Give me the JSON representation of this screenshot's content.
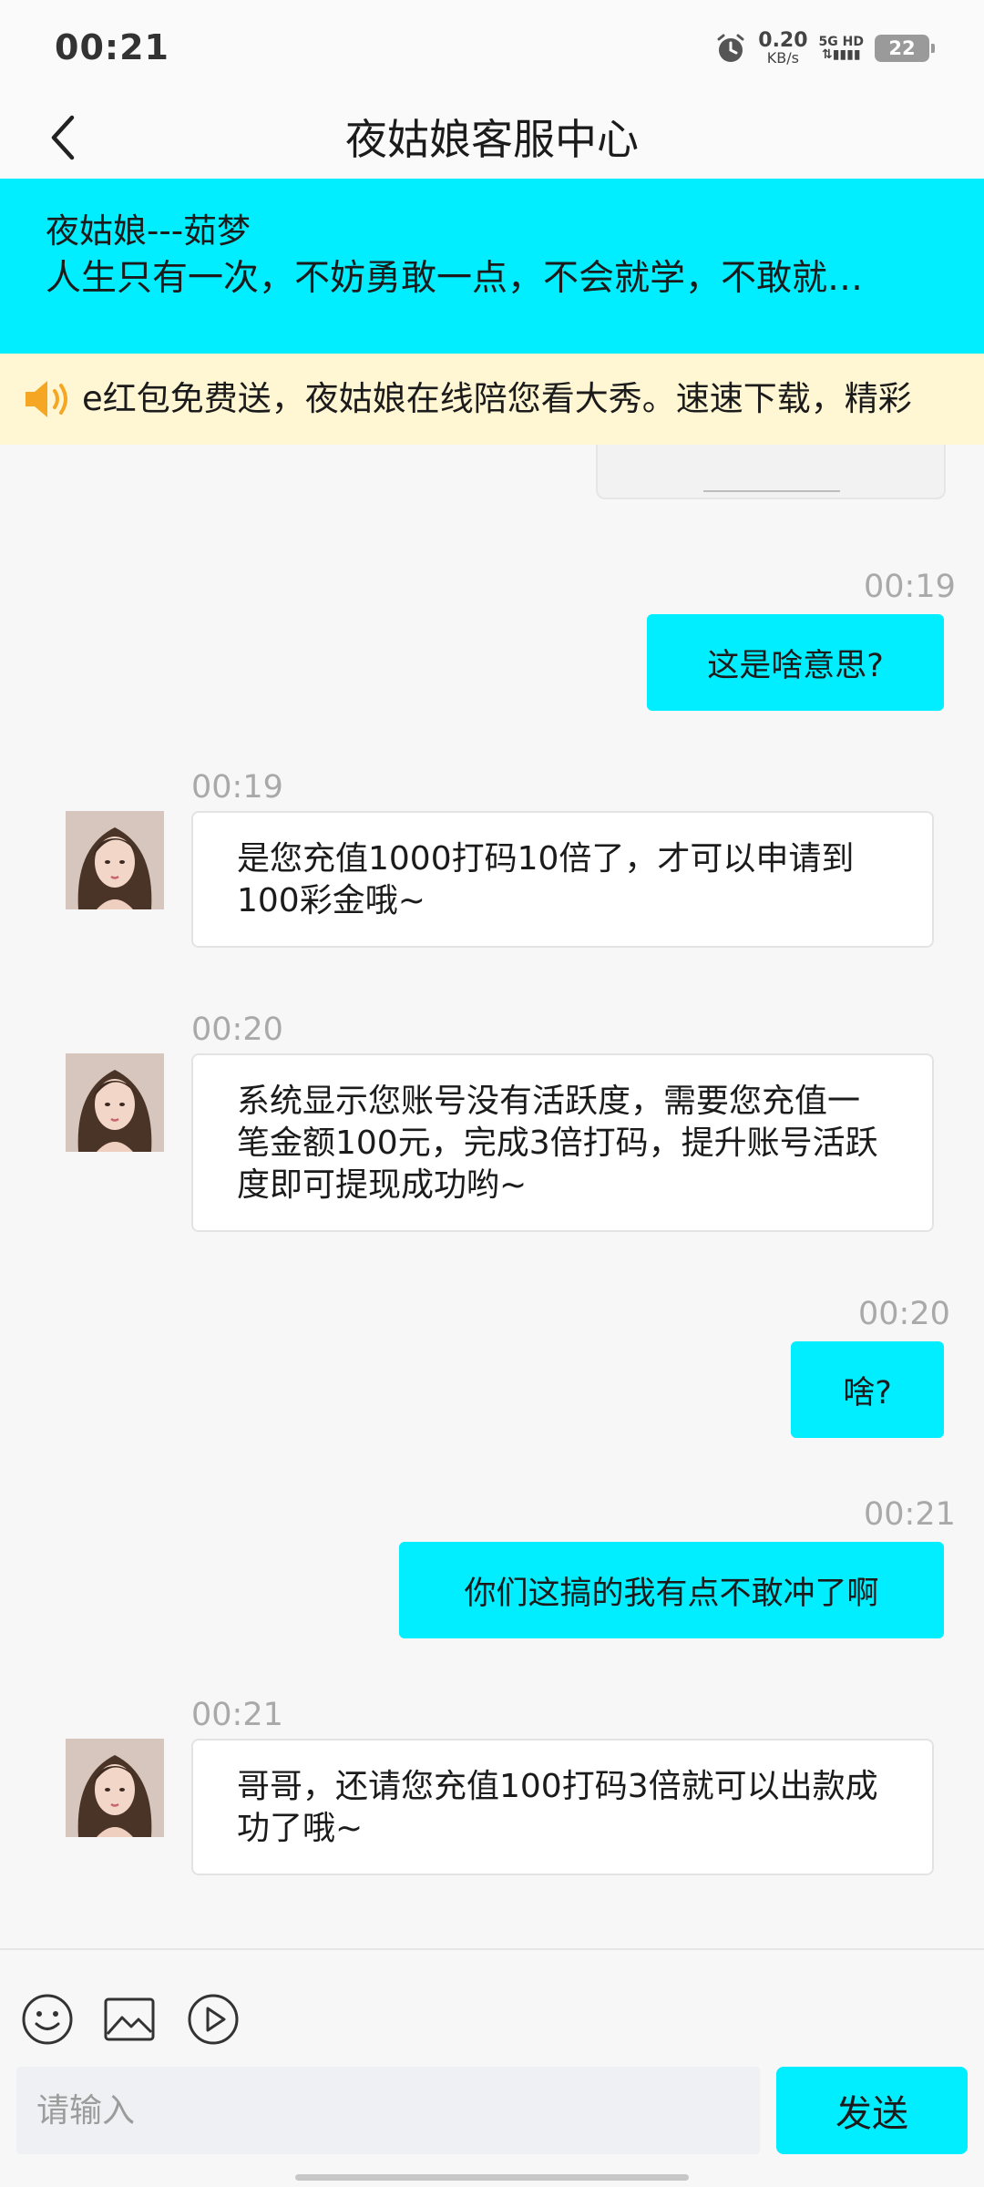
{
  "status_bar": {
    "time": "00:21",
    "speed_value": "0.20",
    "speed_unit": "KB/s",
    "network_top": "5G HD",
    "network_bottom": "⇅▮▮▮▮",
    "battery": "22"
  },
  "header": {
    "title": "夜姑娘客服中心"
  },
  "notice": {
    "name": "夜姑娘---茹梦",
    "message": "人生只有一次，不妨勇敢一点，不会就学，不敢就…"
  },
  "marquee": {
    "text": "e红包免费送，夜姑娘在线陪您看大秀。速速下载，精彩"
  },
  "messages": [
    {
      "side": "right",
      "time": "00:19",
      "text": "这是啥意思?"
    },
    {
      "side": "left",
      "time": "00:19",
      "text": "是您充值1000打码10倍了，才可以申请到100彩金哦~"
    },
    {
      "side": "left",
      "time": "00:20",
      "text": "系统显示您账号没有活跃度，需要您充值一笔金额100元，完成3倍打码，提升账号活跃度即可提现成功哟~"
    },
    {
      "side": "right",
      "time": "00:20",
      "text": "啥?"
    },
    {
      "side": "right",
      "time": "00:21",
      "text": "你们这搞的我有点不敢冲了啊"
    },
    {
      "side": "left",
      "time": "00:21",
      "text": "哥哥，还请您充值100打码3倍就可以出款成功了哦~"
    }
  ],
  "composer": {
    "placeholder": "请输入",
    "send_label": "发送"
  },
  "colors": {
    "accent": "#00eeff",
    "marquee_bg": "#fff6d3",
    "speaker": "#f5a623"
  }
}
